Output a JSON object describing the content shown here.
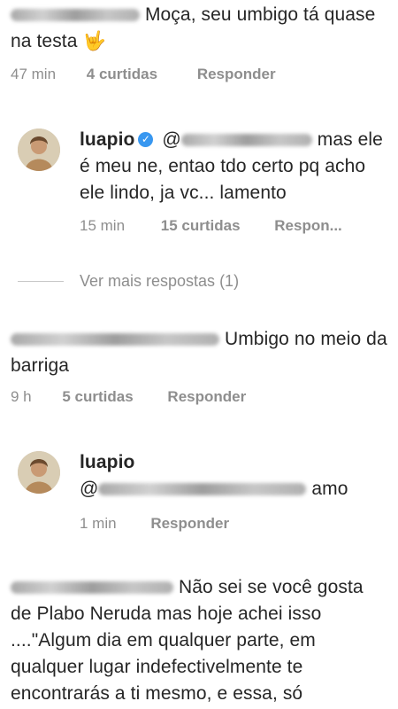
{
  "comments": [
    {
      "text": "Moça, seu umbigo tá quase na testa",
      "emoji": "🤟",
      "time": "47 min",
      "likes": "4 curtidas",
      "reply_label": "Responder"
    },
    {
      "text": "Umbigo no meio da barriga",
      "time": "9 h",
      "likes": "5 curtidas",
      "reply_label": "Responder"
    },
    {
      "text_line1": "Não sei se você",
      "text_rest": "gosta de Plabo Neruda mas hoje achei isso ....\"Algum dia em qualquer parte, em qualquer lugar indefectivelmente te encontrarás a ti mesmo, e essa, só"
    }
  ],
  "replies": [
    {
      "username": "luapio",
      "verified": true,
      "mention_prefix": "@",
      "text": "mas ele é meu ne, entao tdo certo pq acho ele lindo, ja vc... lamento",
      "time": "15 min",
      "likes": "15 curtidas",
      "reply_label": "Respon..."
    },
    {
      "username": "luapio",
      "mention_prefix": "@",
      "text": "amo",
      "time": "1 min",
      "reply_label": "Responder"
    }
  ],
  "view_more": "Ver mais respostas (1)",
  "colors": {
    "verified_badge": "#3897f0",
    "meta_text": "#8e8e8e",
    "text": "#262626"
  },
  "icons": {
    "verified": "verified-badge-icon",
    "avatar": "user-avatar"
  }
}
